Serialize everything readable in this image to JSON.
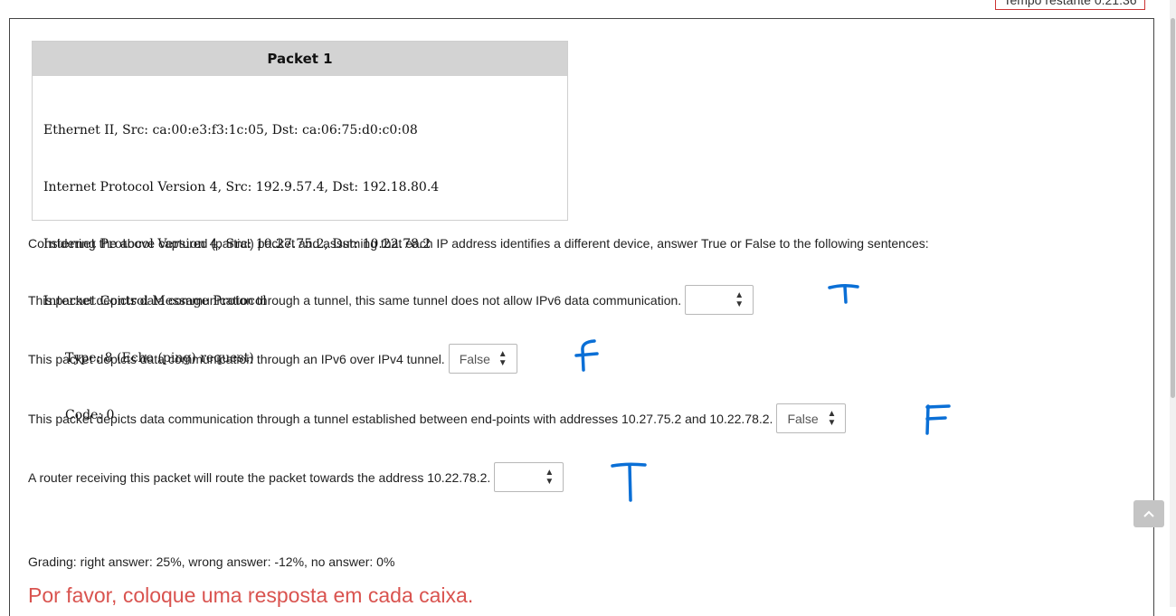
{
  "timer": {
    "label": "Tempo restante 0:21:36"
  },
  "packet": {
    "title": "Packet 1",
    "lines": [
      "Ethernet II, Src: ca:00:e3:f3:1c:05, Dst: ca:06:75:d0:c0:08",
      "Internet Protocol Version 4, Src: 192.9.57.4, Dst: 192.18.80.4",
      "Internet Protocol Version 4, Src: 10.27.75.2, Dst: 10.22.78.2",
      "Internet Control Message Protocol",
      "Type: 8 (Echo (ping) request)",
      "Code: 0"
    ]
  },
  "prompt": "Considering the above captured (partial) packet and assuming that each IP address identifies a different device, answer True or False to the following sentences:",
  "statements": [
    {
      "text": "This packet depicts data communication through a tunnel, this same tunnel does not allow IPv6 data communication.",
      "selected": "",
      "handwritten": "T"
    },
    {
      "text": "This packet depicts data communication through an IPv6 over IPv4 tunnel.",
      "selected": "False",
      "handwritten": "F"
    },
    {
      "text": "This packet depicts data communication through a tunnel established between end-points with addresses 10.27.75.2 and 10.22.78.2.",
      "selected": "False",
      "handwritten": "F"
    },
    {
      "text": "A router receiving this packet will route the packet towards the address 10.22.78.2.",
      "selected": "",
      "handwritten": "T"
    }
  ],
  "grading": "Grading: right answer: 25%, wrong answer: -12%, no answer: 0%",
  "warning": "Por favor, coloque uma resposta em cada caixa.",
  "colors": {
    "ink": "#0a6fd6",
    "warning": "#d9534f",
    "timer_border": "#cc3333"
  },
  "icons": {
    "select_arrow": "up-down-arrows-icon",
    "scroll_top": "chevron-up-icon"
  }
}
